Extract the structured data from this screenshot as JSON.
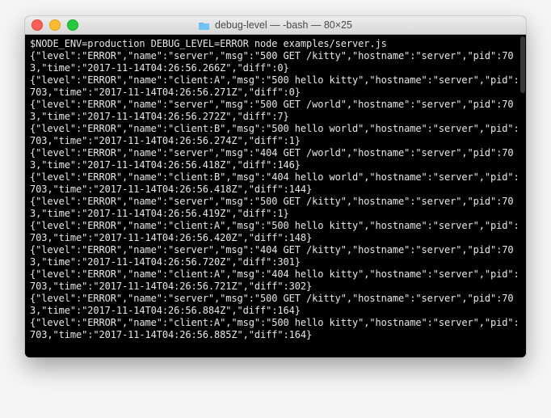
{
  "window": {
    "title_folder": "debug-level",
    "title_suffix": "— -bash — 80×25"
  },
  "prompt": "$ ",
  "command": "NODE_ENV=production DEBUG_LEVEL=ERROR node examples/server.js",
  "log_entries": [
    {
      "level": "ERROR",
      "name": "server",
      "msg": "500 GET /kitty",
      "hostname": "server",
      "pid": 703,
      "time": "2017-11-14T04:26:56.266Z",
      "diff": 0
    },
    {
      "level": "ERROR",
      "name": "client:A",
      "msg": "500 hello kitty",
      "hostname": "server",
      "pid": 703,
      "time": "2017-11-14T04:26:56.271Z",
      "diff": 0
    },
    {
      "level": "ERROR",
      "name": "server",
      "msg": "500 GET /world",
      "hostname": "server",
      "pid": 703,
      "time": "2017-11-14T04:26:56.272Z",
      "diff": 7
    },
    {
      "level": "ERROR",
      "name": "client:B",
      "msg": "500 hello world",
      "hostname": "server",
      "pid": 703,
      "time": "2017-11-14T04:26:56.274Z",
      "diff": 1
    },
    {
      "level": "ERROR",
      "name": "server",
      "msg": "404 GET /world",
      "hostname": "server",
      "pid": 703,
      "time": "2017-11-14T04:26:56.418Z",
      "diff": 146
    },
    {
      "level": "ERROR",
      "name": "client:B",
      "msg": "404 hello world",
      "hostname": "server",
      "pid": 703,
      "time": "2017-11-14T04:26:56.418Z",
      "diff": 144
    },
    {
      "level": "ERROR",
      "name": "server",
      "msg": "500 GET /kitty",
      "hostname": "server",
      "pid": 703,
      "time": "2017-11-14T04:26:56.419Z",
      "diff": 1
    },
    {
      "level": "ERROR",
      "name": "client:A",
      "msg": "500 hello kitty",
      "hostname": "server",
      "pid": 703,
      "time": "2017-11-14T04:26:56.420Z",
      "diff": 148
    },
    {
      "level": "ERROR",
      "name": "server",
      "msg": "404 GET /kitty",
      "hostname": "server",
      "pid": 703,
      "time": "2017-11-14T04:26:56.720Z",
      "diff": 301
    },
    {
      "level": "ERROR",
      "name": "client:A",
      "msg": "404 hello kitty",
      "hostname": "server",
      "pid": 703,
      "time": "2017-11-14T04:26:56.721Z",
      "diff": 302
    },
    {
      "level": "ERROR",
      "name": "server",
      "msg": "500 GET /kitty",
      "hostname": "server",
      "pid": 703,
      "time": "2017-11-14T04:26:56.884Z",
      "diff": 164
    },
    {
      "level": "ERROR",
      "name": "client:A",
      "msg": "500 hello kitty",
      "hostname": "server",
      "pid": 703,
      "time": "2017-11-14T04:26:56.885Z",
      "diff": 164
    }
  ]
}
